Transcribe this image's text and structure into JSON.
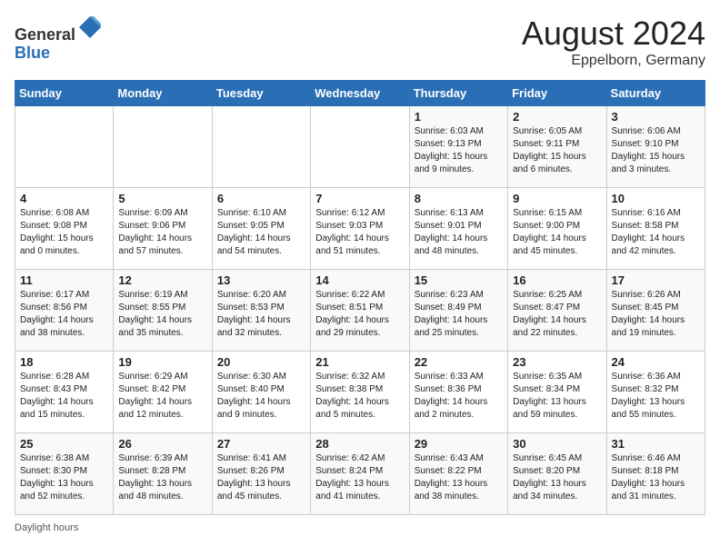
{
  "header": {
    "logo_line1": "General",
    "logo_line2": "Blue",
    "main_title": "August 2024",
    "subtitle": "Eppelborn, Germany"
  },
  "calendar": {
    "days_of_week": [
      "Sunday",
      "Monday",
      "Tuesday",
      "Wednesday",
      "Thursday",
      "Friday",
      "Saturday"
    ],
    "weeks": [
      [
        {
          "day": "",
          "info": ""
        },
        {
          "day": "",
          "info": ""
        },
        {
          "day": "",
          "info": ""
        },
        {
          "day": "",
          "info": ""
        },
        {
          "day": "1",
          "info": "Sunrise: 6:03 AM\nSunset: 9:13 PM\nDaylight: 15 hours and 9 minutes."
        },
        {
          "day": "2",
          "info": "Sunrise: 6:05 AM\nSunset: 9:11 PM\nDaylight: 15 hours and 6 minutes."
        },
        {
          "day": "3",
          "info": "Sunrise: 6:06 AM\nSunset: 9:10 PM\nDaylight: 15 hours and 3 minutes."
        }
      ],
      [
        {
          "day": "4",
          "info": "Sunrise: 6:08 AM\nSunset: 9:08 PM\nDaylight: 15 hours and 0 minutes."
        },
        {
          "day": "5",
          "info": "Sunrise: 6:09 AM\nSunset: 9:06 PM\nDaylight: 14 hours and 57 minutes."
        },
        {
          "day": "6",
          "info": "Sunrise: 6:10 AM\nSunset: 9:05 PM\nDaylight: 14 hours and 54 minutes."
        },
        {
          "day": "7",
          "info": "Sunrise: 6:12 AM\nSunset: 9:03 PM\nDaylight: 14 hours and 51 minutes."
        },
        {
          "day": "8",
          "info": "Sunrise: 6:13 AM\nSunset: 9:01 PM\nDaylight: 14 hours and 48 minutes."
        },
        {
          "day": "9",
          "info": "Sunrise: 6:15 AM\nSunset: 9:00 PM\nDaylight: 14 hours and 45 minutes."
        },
        {
          "day": "10",
          "info": "Sunrise: 6:16 AM\nSunset: 8:58 PM\nDaylight: 14 hours and 42 minutes."
        }
      ],
      [
        {
          "day": "11",
          "info": "Sunrise: 6:17 AM\nSunset: 8:56 PM\nDaylight: 14 hours and 38 minutes."
        },
        {
          "day": "12",
          "info": "Sunrise: 6:19 AM\nSunset: 8:55 PM\nDaylight: 14 hours and 35 minutes."
        },
        {
          "day": "13",
          "info": "Sunrise: 6:20 AM\nSunset: 8:53 PM\nDaylight: 14 hours and 32 minutes."
        },
        {
          "day": "14",
          "info": "Sunrise: 6:22 AM\nSunset: 8:51 PM\nDaylight: 14 hours and 29 minutes."
        },
        {
          "day": "15",
          "info": "Sunrise: 6:23 AM\nSunset: 8:49 PM\nDaylight: 14 hours and 25 minutes."
        },
        {
          "day": "16",
          "info": "Sunrise: 6:25 AM\nSunset: 8:47 PM\nDaylight: 14 hours and 22 minutes."
        },
        {
          "day": "17",
          "info": "Sunrise: 6:26 AM\nSunset: 8:45 PM\nDaylight: 14 hours and 19 minutes."
        }
      ],
      [
        {
          "day": "18",
          "info": "Sunrise: 6:28 AM\nSunset: 8:43 PM\nDaylight: 14 hours and 15 minutes."
        },
        {
          "day": "19",
          "info": "Sunrise: 6:29 AM\nSunset: 8:42 PM\nDaylight: 14 hours and 12 minutes."
        },
        {
          "day": "20",
          "info": "Sunrise: 6:30 AM\nSunset: 8:40 PM\nDaylight: 14 hours and 9 minutes."
        },
        {
          "day": "21",
          "info": "Sunrise: 6:32 AM\nSunset: 8:38 PM\nDaylight: 14 hours and 5 minutes."
        },
        {
          "day": "22",
          "info": "Sunrise: 6:33 AM\nSunset: 8:36 PM\nDaylight: 14 hours and 2 minutes."
        },
        {
          "day": "23",
          "info": "Sunrise: 6:35 AM\nSunset: 8:34 PM\nDaylight: 13 hours and 59 minutes."
        },
        {
          "day": "24",
          "info": "Sunrise: 6:36 AM\nSunset: 8:32 PM\nDaylight: 13 hours and 55 minutes."
        }
      ],
      [
        {
          "day": "25",
          "info": "Sunrise: 6:38 AM\nSunset: 8:30 PM\nDaylight: 13 hours and 52 minutes."
        },
        {
          "day": "26",
          "info": "Sunrise: 6:39 AM\nSunset: 8:28 PM\nDaylight: 13 hours and 48 minutes."
        },
        {
          "day": "27",
          "info": "Sunrise: 6:41 AM\nSunset: 8:26 PM\nDaylight: 13 hours and 45 minutes."
        },
        {
          "day": "28",
          "info": "Sunrise: 6:42 AM\nSunset: 8:24 PM\nDaylight: 13 hours and 41 minutes."
        },
        {
          "day": "29",
          "info": "Sunrise: 6:43 AM\nSunset: 8:22 PM\nDaylight: 13 hours and 38 minutes."
        },
        {
          "day": "30",
          "info": "Sunrise: 6:45 AM\nSunset: 8:20 PM\nDaylight: 13 hours and 34 minutes."
        },
        {
          "day": "31",
          "info": "Sunrise: 6:46 AM\nSunset: 8:18 PM\nDaylight: 13 hours and 31 minutes."
        }
      ]
    ],
    "footer_note": "Daylight hours"
  }
}
